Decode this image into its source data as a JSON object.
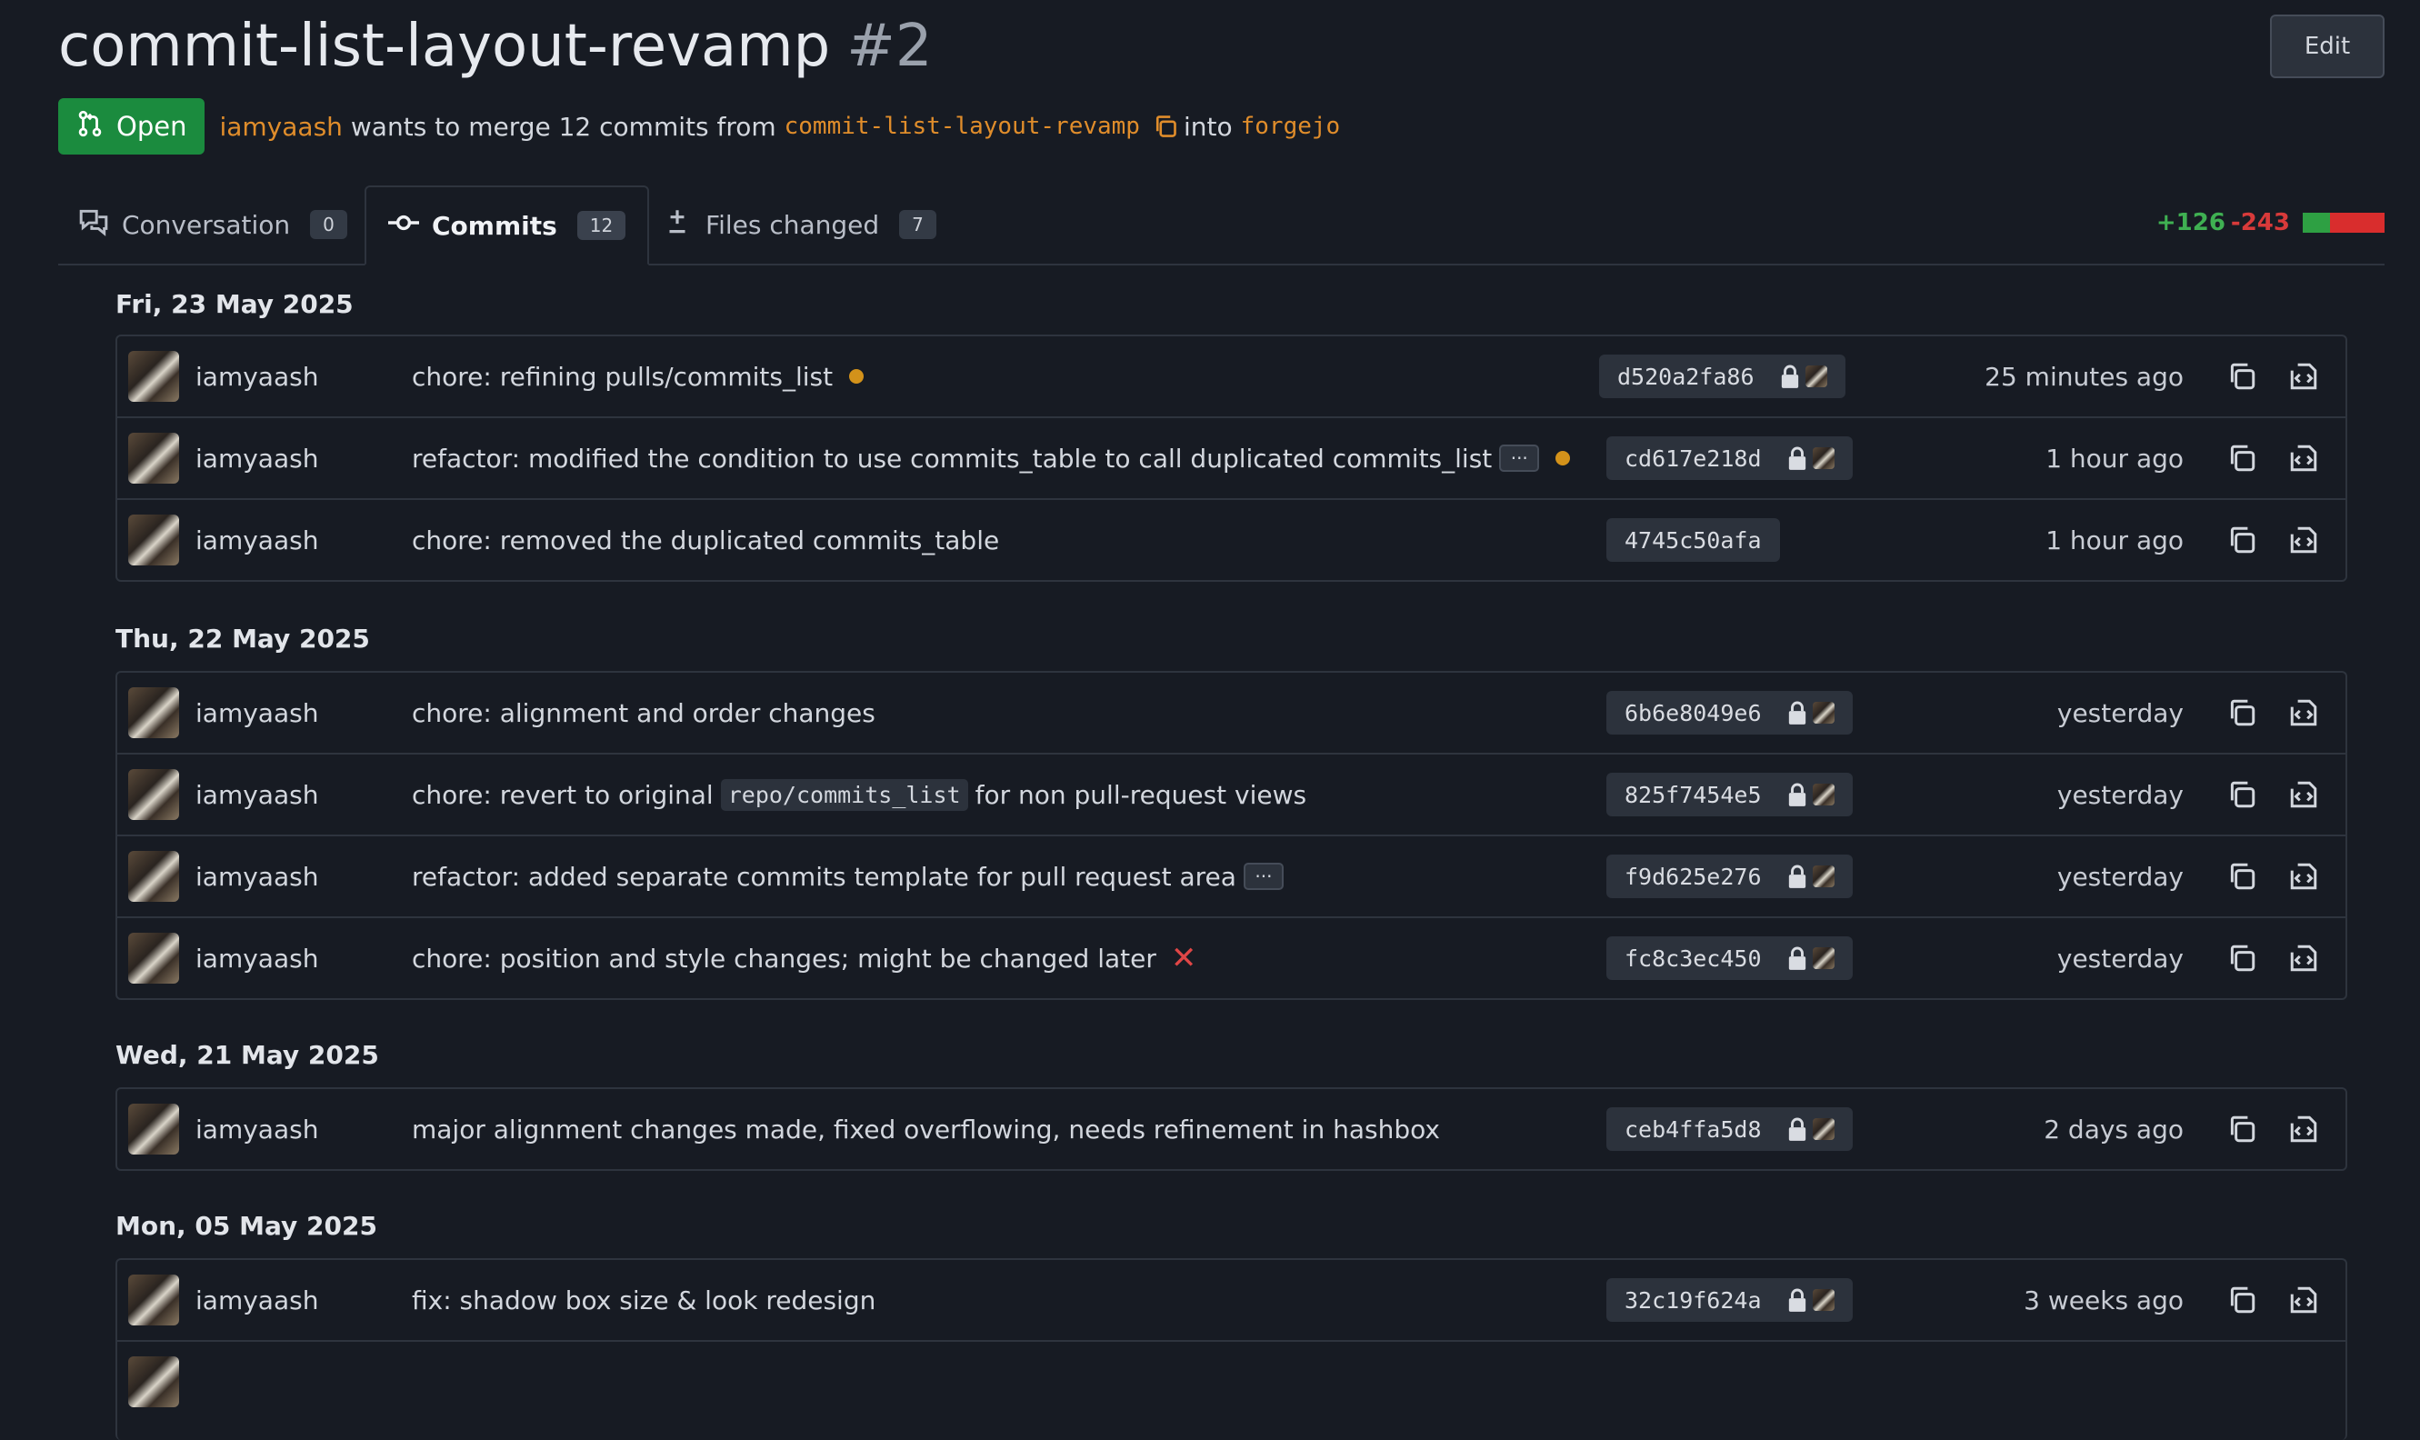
{
  "header": {
    "title": "commit-list-layout-revamp",
    "number": "#2",
    "edit_label": "Edit"
  },
  "meta": {
    "status": "Open",
    "user": "iamyaash",
    "text_merge": "wants to merge 12 commits from",
    "head_branch": "commit-list-layout-revamp",
    "text_into": "into",
    "base_branch": "forgejo"
  },
  "tabs": [
    {
      "label": "Conversation",
      "count": "0",
      "icon": "comment-icon"
    },
    {
      "label": "Commits",
      "count": "12",
      "icon": "commit-icon"
    },
    {
      "label": "Files changed",
      "count": "7",
      "icon": "diff-icon"
    }
  ],
  "diffstat": {
    "additions": "+126",
    "deletions": "-243",
    "add_color": "#3fb052",
    "del_color": "#d83a3a"
  },
  "groups": [
    {
      "date": "Fri, 23 May 2025",
      "commits": [
        {
          "author": "iamyaash",
          "message": "chore: refining pulls/commits_list",
          "sha": "d520a2fa86",
          "time": "25 minutes ago",
          "status": "pending"
        },
        {
          "author": "iamyaash",
          "message": "refactor: modified the condition to use commits_table to call duplicated commits_list",
          "sha": "cd617e218d",
          "time": "1 hour ago",
          "status": "pending"
        },
        {
          "author": "iamyaash",
          "message": "chore: removed the duplicated commits_table",
          "sha": "4745c50afa",
          "time": "1 hour ago",
          "status": "none"
        }
      ]
    },
    {
      "date": "Thu, 22 May 2025",
      "commits": [
        {
          "author": "iamyaash",
          "message": "chore: alignment and order changes",
          "sha": "6b6e8049e6",
          "time": "yesterday"
        },
        {
          "author": "iamyaash",
          "message_pre": "chore: revert to original",
          "message_code": "repo/commits_list",
          "message_post": "for non pull-request views",
          "sha": "825f7454e5",
          "time": "yesterday"
        },
        {
          "author": "iamyaash",
          "message": "refactor: added separate commits template for pull request area",
          "sha": "f9d625e276",
          "time": "yesterday"
        },
        {
          "author": "iamyaash",
          "message": "chore: position and style changes; might be changed later",
          "sha": "fc8c3ec450",
          "time": "yesterday",
          "status": "failed"
        }
      ]
    },
    {
      "date": "Wed, 21 May 2025",
      "commits": [
        {
          "author": "iamyaash",
          "message": "major alignment changes made, fixed overflowing, needs refinement in hashbox",
          "sha": "ceb4ffa5d8",
          "time": "2 days ago"
        }
      ]
    },
    {
      "date": "Mon, 05 May 2025",
      "commits": [
        {
          "author": "iamyaash",
          "message": "fix: shadow box size & look redesign",
          "sha": "32c19f624a",
          "time": "3 weeks ago"
        }
      ]
    }
  ]
}
